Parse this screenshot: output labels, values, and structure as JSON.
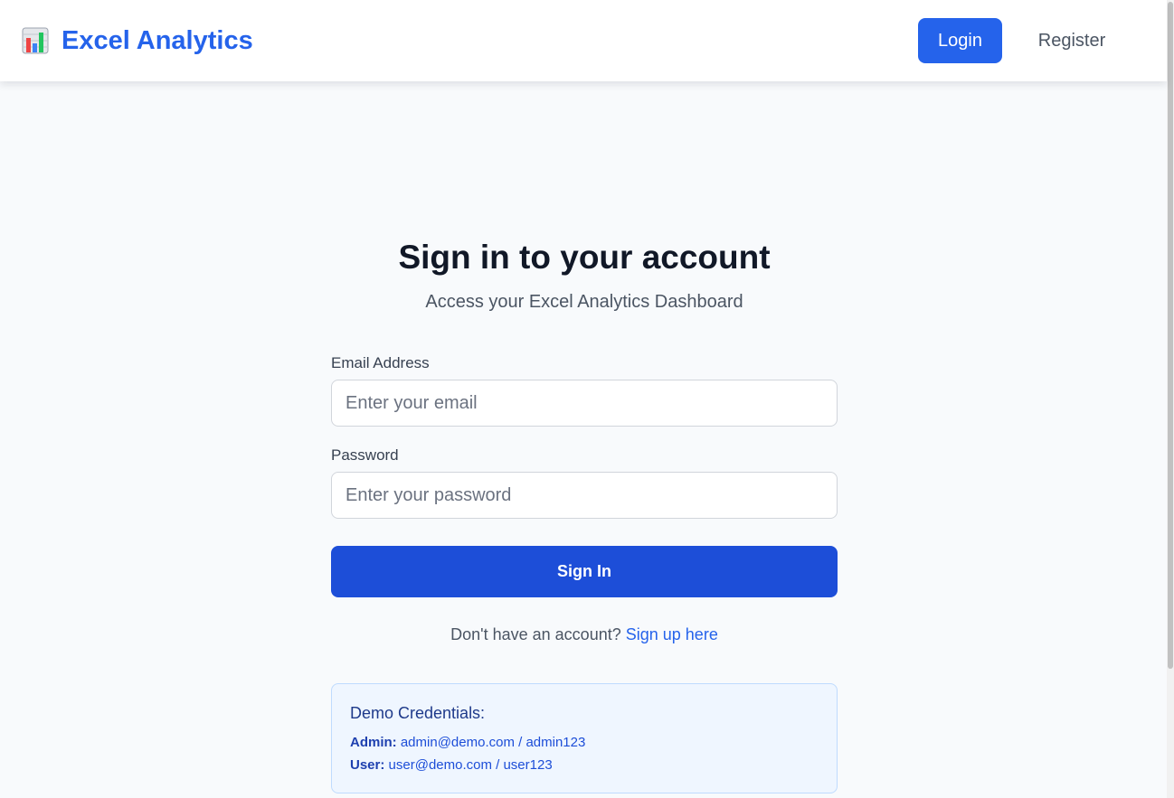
{
  "header": {
    "brand_icon": "bar-chart-icon",
    "brand_name": "Excel Analytics",
    "login_label": "Login",
    "register_label": "Register"
  },
  "login": {
    "title": "Sign in to your account",
    "subtitle": "Access your Excel Analytics Dashboard",
    "email_label": "Email Address",
    "email_placeholder": "Enter your email",
    "email_value": "",
    "password_label": "Password",
    "password_placeholder": "Enter your password",
    "password_value": "",
    "submit_label": "Sign In",
    "signup_prompt": "Don't have an account?",
    "signup_link": "Sign up here"
  },
  "demo": {
    "title": "Demo Credentials:",
    "accounts": [
      {
        "role": "Admin:",
        "credentials": "admin@demo.com / admin123"
      },
      {
        "role": "User:",
        "credentials": "user@demo.com / user123"
      }
    ]
  },
  "colors": {
    "accent": "#2563eb",
    "submit": "#1d4ed8",
    "background": "#f8fafc",
    "demo_background": "#eff6ff"
  }
}
